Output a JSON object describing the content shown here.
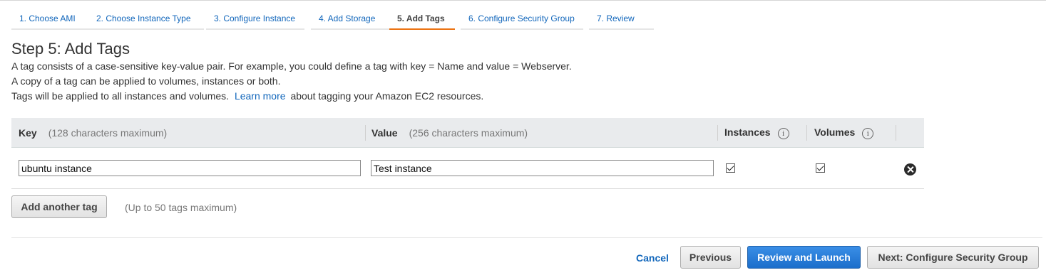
{
  "wizard": {
    "tabs": [
      {
        "label": "1. Choose AMI"
      },
      {
        "label": "2. Choose Instance Type"
      },
      {
        "label": "3. Configure Instance"
      },
      {
        "label": "4. Add Storage"
      },
      {
        "label": "5. Add Tags",
        "active": true
      },
      {
        "label": "6. Configure Security Group"
      },
      {
        "label": "7. Review"
      }
    ]
  },
  "page": {
    "title": "Step 5: Add Tags",
    "desc_line1": "A tag consists of a case-sensitive key-value pair. For example, you could define a tag with key = Name and value = Webserver.",
    "desc_line2": "A copy of a tag can be applied to volumes, instances or both.",
    "desc_line3_prefix": "Tags will be applied to all instances and volumes.",
    "learn_more": "Learn more",
    "desc_line3_suffix": "about tagging your Amazon EC2 resources."
  },
  "table": {
    "headers": {
      "key": "Key",
      "key_hint": "(128 characters maximum)",
      "value": "Value",
      "value_hint": "(256 characters maximum)",
      "instances": "Instances",
      "volumes": "Volumes"
    },
    "rows": [
      {
        "key": "ubuntu instance",
        "value": "Test instance",
        "instances": true,
        "volumes": true
      }
    ]
  },
  "actions": {
    "add_tag": "Add another tag",
    "add_tag_hint": "(Up to 50 tags maximum)",
    "cancel": "Cancel",
    "previous": "Previous",
    "review_launch": "Review and Launch",
    "next": "Next: Configure Security Group"
  },
  "colors": {
    "link": "#1166bb",
    "active_tab_underline": "#ec7211",
    "primary_button": "#1c6ecb"
  }
}
